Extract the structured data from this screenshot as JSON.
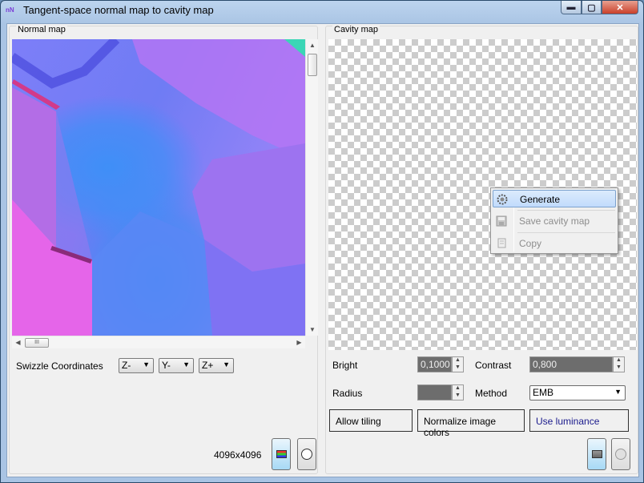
{
  "window": {
    "title": "Tangent-space normal map to cavity map",
    "icon_text": "nN",
    "controls": {
      "minimize": "▬",
      "maximize": "▢",
      "close": "✕"
    }
  },
  "normal_map": {
    "label": "Normal map",
    "swizzle_label": "Swizzle Coordinates",
    "swizzle": [
      "Z-",
      "Y-",
      "Z+"
    ],
    "resolution": "4096x4096",
    "scroll_thumb_grip": "III"
  },
  "cavity_map": {
    "label": "Cavity map",
    "bright_label": "Bright",
    "bright_value": "0,1000",
    "contrast_label": "Contrast",
    "contrast_value": "0,800",
    "radius_label": "Radius",
    "radius_value": "",
    "method_label": "Method",
    "method_value": "EMB",
    "allow_tiling": "Allow tiling",
    "normalize_colors": "Normalize image colors",
    "use_luminance": "Use luminance"
  },
  "context_menu": {
    "items": [
      {
        "label": "Generate",
        "icon": "gear-icon",
        "highlighted": true,
        "enabled": true
      },
      {
        "label": "Save cavity map",
        "icon": "floppy-icon",
        "highlighted": false,
        "enabled": false
      },
      {
        "label": "Copy",
        "icon": "copy-icon",
        "highlighted": false,
        "enabled": false
      }
    ]
  },
  "colors": {
    "accent": "#3399ff",
    "highlight": "#c1dbfc",
    "disabled_text": "#8d8d8d"
  }
}
